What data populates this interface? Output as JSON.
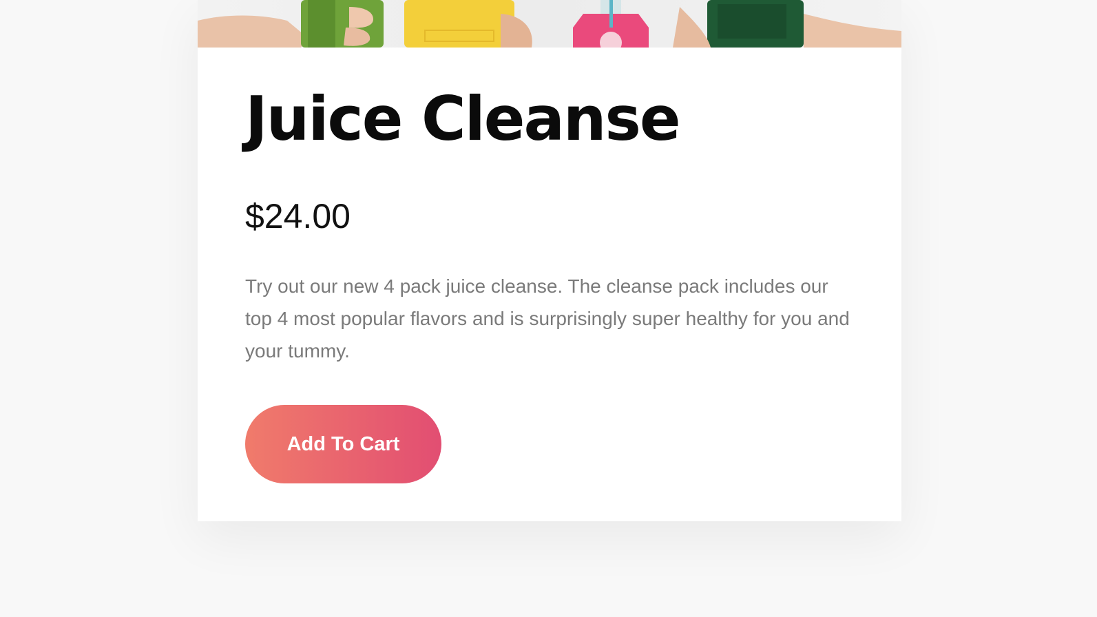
{
  "product": {
    "title": "Juice Cleanse",
    "price": "$24.00",
    "description": "Try out our new 4 pack juice cleanse. The cleanse pack includes our top 4 most popular flavors and is surprisingly super healthy for you and your tummy.",
    "add_to_cart_label": "Add To Cart"
  },
  "hero_image": {
    "icon": "juice-bottles-photo",
    "bottle_colors": [
      "#6fa33a",
      "#f3cf3a",
      "#ea4a7c",
      "#1f5a35"
    ]
  },
  "colors": {
    "accent_start": "#f07b6b",
    "accent_end": "#e24e72",
    "title": "#0b0b0b",
    "body_text": "#7a7a7a"
  }
}
